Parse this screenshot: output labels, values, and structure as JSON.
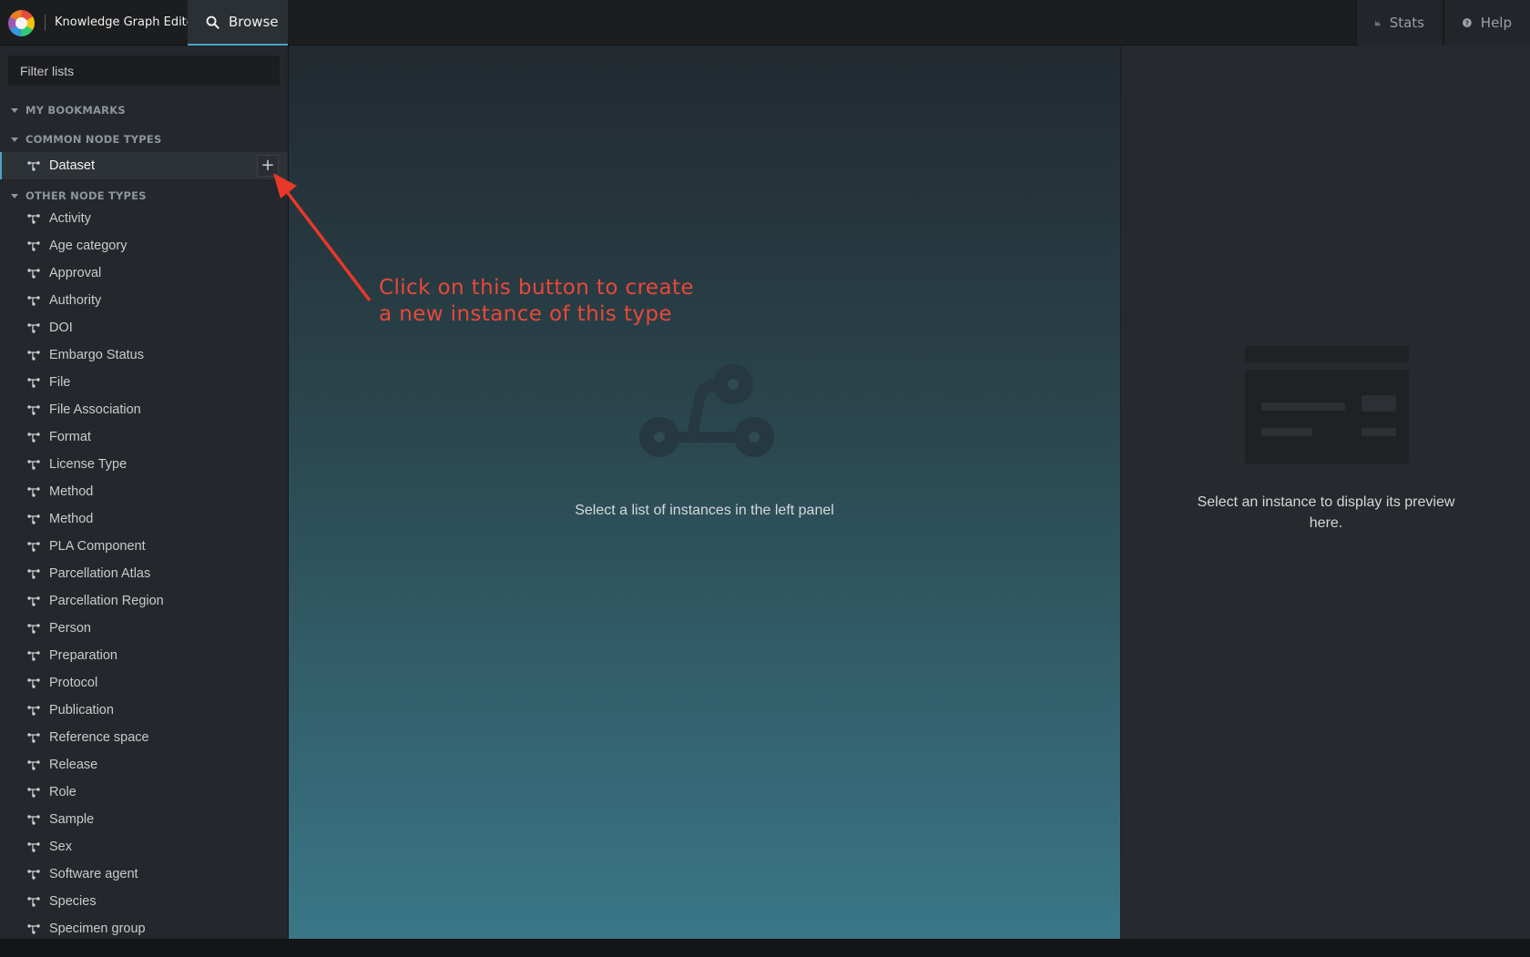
{
  "header": {
    "app_title": "Knowledge Graph Editor",
    "browse_tab": "Browse",
    "stats_button": "Stats",
    "help_button": "Help"
  },
  "sidebar": {
    "filter_placeholder": "Filter lists",
    "sections": {
      "bookmarks": "MY BOOKMARKS",
      "common": "COMMON NODE TYPES",
      "other": "OTHER NODE TYPES"
    },
    "common_items": [
      "Dataset"
    ],
    "other_items": [
      "Activity",
      "Age category",
      "Approval",
      "Authority",
      "DOI",
      "Embargo Status",
      "File",
      "File Association",
      "Format",
      "License Type",
      "Method",
      "Method",
      "PLA Component",
      "Parcellation Atlas",
      "Parcellation Region",
      "Person",
      "Preparation",
      "Protocol",
      "Publication",
      "Reference space",
      "Release",
      "Role",
      "Sample",
      "Sex",
      "Software agent",
      "Species",
      "Specimen group"
    ],
    "add_button_symbol": "+"
  },
  "center": {
    "message": "Select a list of instances in the left panel"
  },
  "right": {
    "message": "Select an instance to display its preview here."
  },
  "annotation": {
    "line1": "Click on this button to create",
    "line2": "a new instance of this type",
    "color": "#e8483a"
  },
  "colors": {
    "accent": "#4aa3c7",
    "topbar_bg": "#1b1d1f",
    "sidebar_bg": "#24272b"
  }
}
